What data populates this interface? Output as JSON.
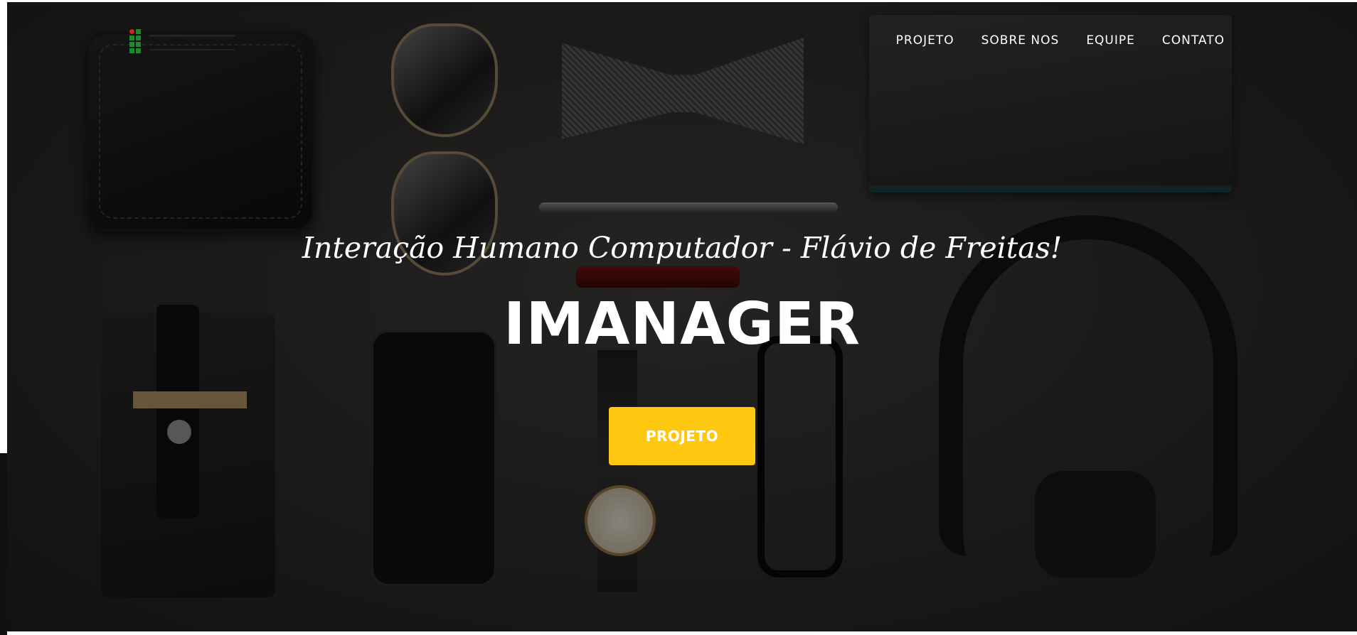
{
  "brand": {
    "logo_name": "institution-logo",
    "colors": {
      "green": "#1b8b2d",
      "red": "#d51f26"
    }
  },
  "nav": {
    "items": [
      {
        "label": "PROJETO"
      },
      {
        "label": "SOBRE NOS"
      },
      {
        "label": "EQUIPE"
      },
      {
        "label": "CONTATO"
      }
    ]
  },
  "hero": {
    "subheading": "Interação Humano Computador - Flávio de Freitas!",
    "heading": "IMANAGER",
    "cta_label": "PROJETO",
    "colors": {
      "cta_background": "#fec810",
      "text": "#ffffff"
    }
  }
}
